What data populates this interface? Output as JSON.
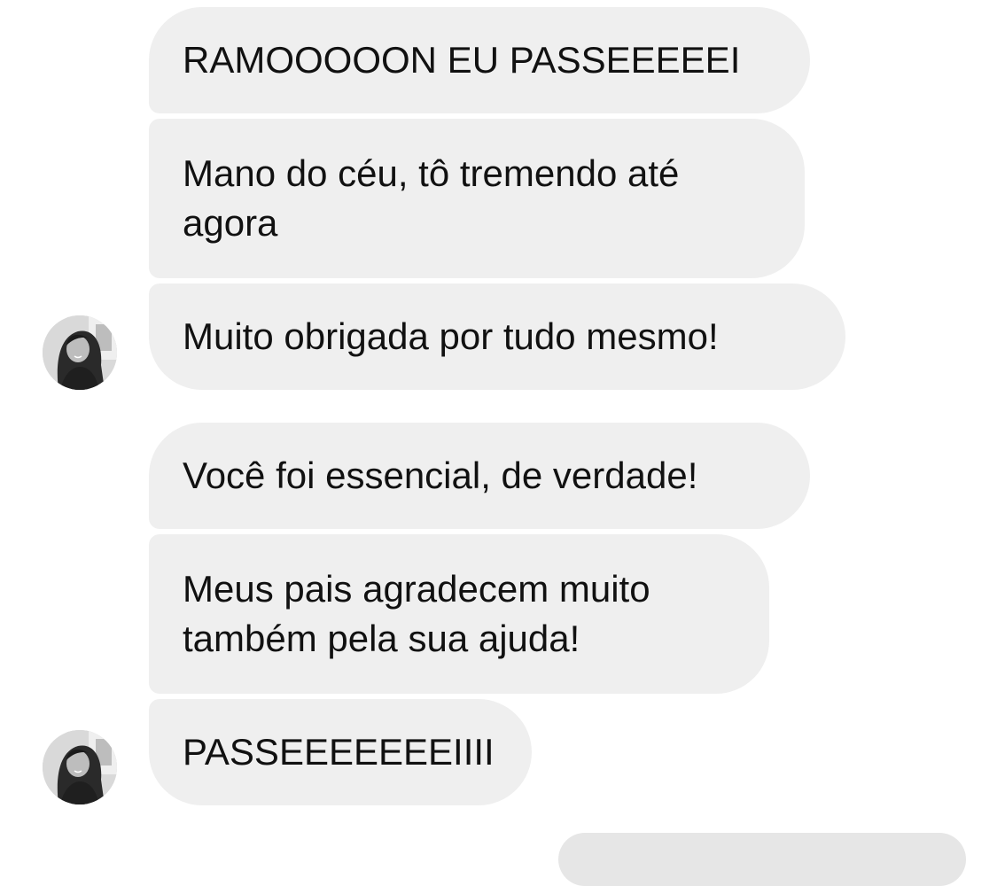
{
  "conversation": {
    "messages": [
      {
        "text": "RAMOOOOON EU PASSEEEEEI",
        "sender": "contact"
      },
      {
        "text": "Mano do céu, tô tremendo até\nagora",
        "sender": "contact"
      },
      {
        "text": "Muito obrigada por tudo mesmo!",
        "sender": "contact"
      },
      {
        "text": "Você foi essencial, de verdade!",
        "sender": "contact"
      },
      {
        "text": "Meus pais agradecem muito\ntambém pela sua ajuda!",
        "sender": "contact"
      },
      {
        "text": "PASSEEEEEEEIIII",
        "sender": "contact"
      }
    ]
  },
  "colors": {
    "incoming_bubble": "#efefef",
    "text": "#111111",
    "background": "#ffffff"
  },
  "icons": {
    "avatar": "contact-avatar-photo"
  }
}
